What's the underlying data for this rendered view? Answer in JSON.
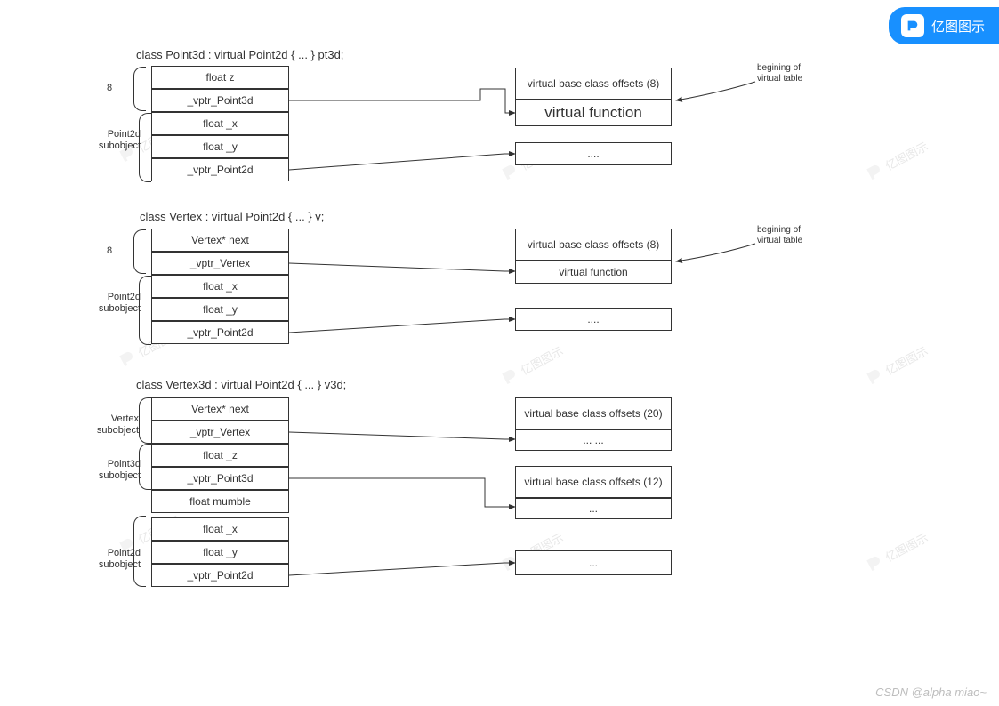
{
  "badge": {
    "label": "亿图图示"
  },
  "watermarks": {
    "text": "亿图图示"
  },
  "footer": "CSDN @alpha miao~",
  "diagrams": {
    "point3d": {
      "title": "class Point3d : virtual Point2d { ... } pt3d;",
      "size_label": "8",
      "sub_label": "Point2d\nsubobject",
      "cells": [
        "float z",
        "_vptr_Point3d",
        "float _x",
        "float _y",
        "_vptr_Point2d"
      ],
      "vt_offsets": "virtual base class offsets (8)",
      "vt_func": "virtual function",
      "vt_dots": "....",
      "caption": "begining of\nvirtual table"
    },
    "vertex": {
      "title": "class Vertex : virtual Point2d { ... } v;",
      "size_label": "8",
      "sub_label": "Point2d\nsubobject",
      "cells": [
        "Vertex* next",
        "_vptr_Vertex",
        "float _x",
        "float _y",
        "_vptr_Point2d"
      ],
      "vt_offsets": "virtual base class offsets (8)",
      "vt_func": "virtual function",
      "vt_dots": "....",
      "caption": "begining of\nvirtual table"
    },
    "vertex3d": {
      "title": "class Vertex3d : virtual Point2d { ... } v3d;",
      "labels": {
        "vertex_sub": "Vertex\nsubobject",
        "point3d_sub": "Point3d\nsubobject",
        "point2d_sub": "Point2d\nsubobject"
      },
      "cells": [
        "Vertex* next",
        "_vptr_Vertex",
        "float _z",
        "_vptr_Point3d",
        "float mumble",
        "float _x",
        "float _y",
        "_vptr_Point2d"
      ],
      "vt1_offsets": "virtual base class offsets (20)",
      "vt1_dots": "...     ...",
      "vt2_offsets": "virtual base class offsets (12)",
      "vt2_dots": "...",
      "vt3_dots": "..."
    }
  }
}
